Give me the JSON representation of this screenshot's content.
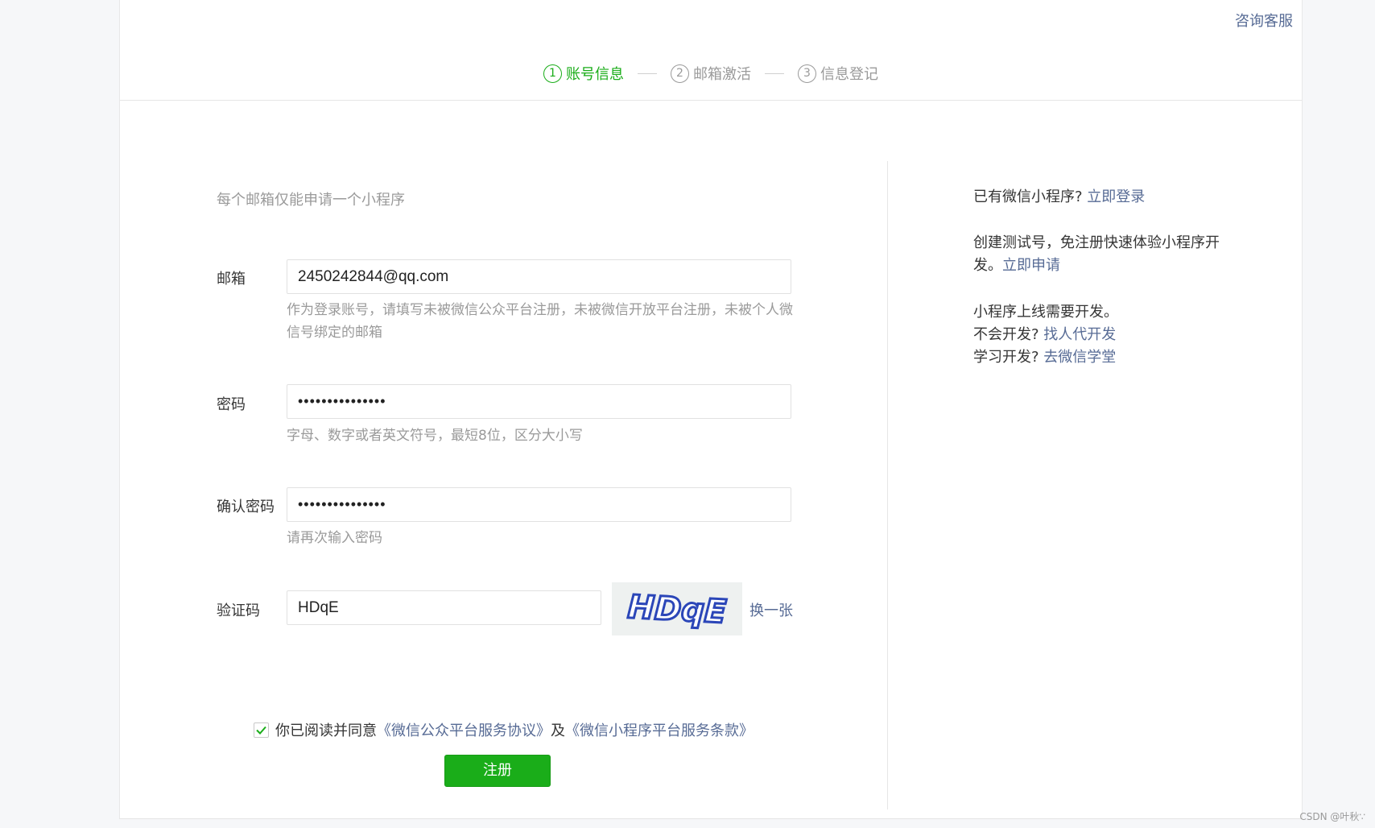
{
  "header": {
    "consult_label": "咨询客服",
    "steps": [
      {
        "num": "1",
        "label": "账号信息",
        "active": true
      },
      {
        "num": "2",
        "label": "邮箱激活",
        "active": false
      },
      {
        "num": "3",
        "label": "信息登记",
        "active": false
      }
    ]
  },
  "form": {
    "tip": "每个邮箱仅能申请一个小程序",
    "email": {
      "label": "邮箱",
      "value": "2450242844@qq.com",
      "hint": "作为登录账号，请填写未被微信公众平台注册，未被微信开放平台注册，未被个人微信号绑定的邮箱"
    },
    "password": {
      "label": "密码",
      "value": "•••••••••••••••",
      "hint": "字母、数字或者英文符号，最短8位，区分大小写"
    },
    "confirm": {
      "label": "确认密码",
      "value": "•••••••••••••••",
      "hint": "请再次输入密码"
    },
    "captcha": {
      "label": "验证码",
      "value": "HDqE",
      "image_text": "HDqE",
      "refresh_label": "换一张"
    },
    "agreement": {
      "checked": true,
      "prefix": "你已阅读并同意",
      "link1": "《微信公众平台服务协议》",
      "middle": "及",
      "link2": "《微信小程序平台服务条款》"
    },
    "submit_label": "注册"
  },
  "sidebar": {
    "login_prefix": "已有微信小程序?",
    "login_link": "立即登录",
    "test_text": "创建测试号，免注册快速体验小程序开发。",
    "test_link": "立即申请",
    "dev_line": "小程序上线需要开发。",
    "no_dev_prefix": "不会开发?",
    "no_dev_link": "找人代开发",
    "learn_prefix": "学习开发?",
    "learn_link": "去微信学堂"
  },
  "watermark": "CSDN @叶秋∵",
  "colors": {
    "accent": "#1aad19",
    "link": "#576b95",
    "muted": "#9a9a9a"
  }
}
